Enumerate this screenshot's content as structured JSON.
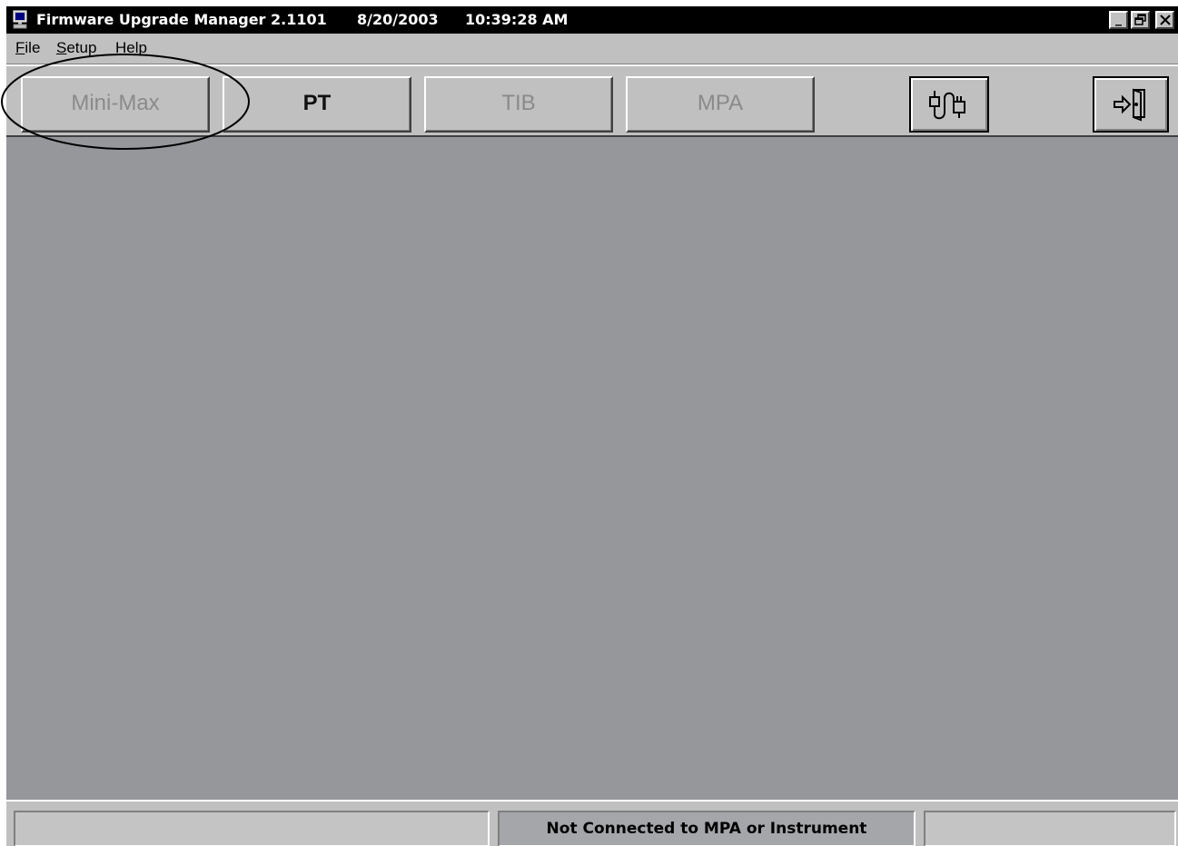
{
  "window": {
    "title": "Firmware Upgrade Manager 2.1101",
    "date": "8/20/2003",
    "time": "10:39:28 AM",
    "controls": {
      "minimize": "_",
      "restore": "🗗",
      "close": "✕"
    }
  },
  "menu": {
    "file": {
      "accel": "F",
      "rest": "ile"
    },
    "setup": {
      "accel": "S",
      "rest": "etup"
    },
    "help": {
      "accel": "H",
      "rest": "elp"
    }
  },
  "toolbar": {
    "minimax": {
      "label": "Mini-Max",
      "state": "disabled"
    },
    "pt": {
      "label": "PT",
      "state": "enabled"
    },
    "tib": {
      "label": "TIB",
      "state": "disabled"
    },
    "mpa": {
      "label": "MPA",
      "state": "disabled"
    },
    "connect": {
      "icon": "plug-connect-icon"
    },
    "exit": {
      "icon": "exit-door-icon"
    }
  },
  "status": {
    "left": "",
    "middle": "Not Connected to MPA or Instrument",
    "right": ""
  },
  "colors": {
    "titlebar": "#000000",
    "chrome": "#c0c0c0",
    "workspace": "#96979b",
    "status_middle": "#a5a6aa"
  }
}
